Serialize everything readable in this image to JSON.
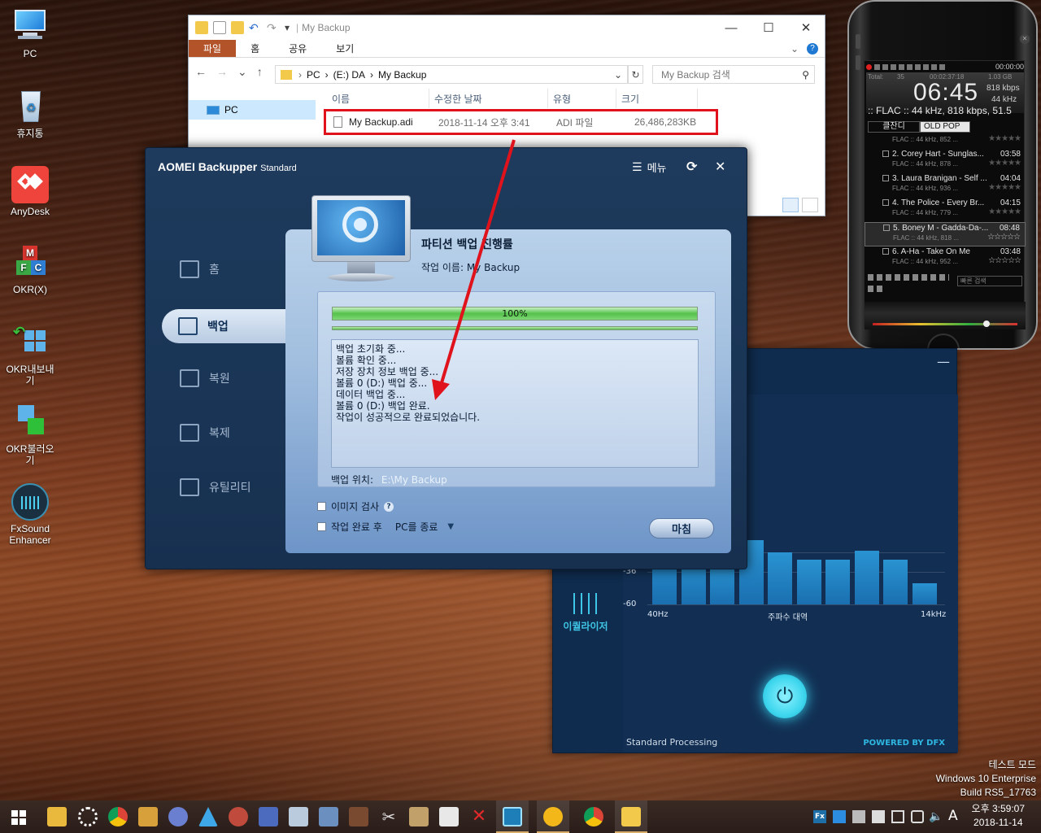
{
  "desktop": {
    "icons": [
      {
        "label": "PC",
        "name": "pc-icon"
      },
      {
        "label": "휴지통",
        "name": "recycle-bin-icon"
      },
      {
        "label": "AnyDesk",
        "name": "anydesk-icon"
      },
      {
        "label": "OKR(X)",
        "name": "okr-x-icon"
      },
      {
        "label": "OKR내보내기",
        "name": "okr-export-icon"
      },
      {
        "label": "OKR불러오기",
        "name": "okr-import-icon"
      },
      {
        "label": "FxSound\nEnhancer",
        "name": "fxsound-icon"
      }
    ]
  },
  "explorer": {
    "title": "My Backup",
    "ribbon_tabs": [
      "파일",
      "홈",
      "공유",
      "보기"
    ],
    "path": [
      "PC",
      "(E:) DA",
      "My Backup"
    ],
    "search_placeholder": "My Backup 검색",
    "sidebar_pc": "PC",
    "columns": [
      "이름",
      "수정한 날짜",
      "유형",
      "크기"
    ],
    "file": {
      "name": "My Backup.adi",
      "date": "2018-11-14 오후 3:41",
      "type": "ADI 파일",
      "size": "26,486,283KB"
    }
  },
  "aomei": {
    "title": "AOMEI Backupper",
    "edition": "Standard",
    "menu_label": "메뉴",
    "nav": [
      "홈",
      "백업",
      "복원",
      "복제",
      "유틸리티"
    ],
    "heading": "파티션 백업 진행률",
    "job_name": "작업 이름: My Backup",
    "progress": 1.0,
    "progress_label": "100%",
    "log": [
      "백업 초기화 중...",
      "볼륨 확인 중...",
      "저장 장치 정보 백업 중...",
      "볼륨 0 (D:) 백업 중...",
      "데이터 백업 중...",
      "볼륨 0 (D:) 백업 완료.",
      "작업이 성공적으로 완료되었습니다."
    ],
    "location_label": "백업 위치:",
    "location_path": "E:\\My Backup",
    "check_image": "이미지 검사",
    "check_after": "작업 완료 후",
    "after_action": "PC를 종료",
    "finish_label": "마침"
  },
  "fxsound": {
    "ticks": [
      "-36",
      "-60"
    ],
    "axis": [
      "40Hz",
      "주파수 대역",
      "14kHz"
    ],
    "eq_label": "이퀄라이저",
    "mode": "Standard Processing",
    "powered": "POWERED BY DFX",
    "bands": [
      0.55,
      0.44,
      0.36,
      0.61,
      0.49,
      0.42,
      0.42,
      0.51,
      0.42,
      0.2
    ]
  },
  "player": {
    "elapsed": "00:00:00",
    "total_label": "Total:",
    "total_count": "35",
    "total_time": "00:02:37:18",
    "total_size": "1.03 GB",
    "clock": "06:45",
    "bitrate": "818 kbps",
    "samplerate": "44 kHz",
    "now_format": ":: FLAC :: 44 kHz, 818 kbps, 51.5",
    "tabs": [
      "클잔디",
      "OLD POP ..."
    ],
    "tracks": [
      {
        "title": "",
        "dur": "",
        "info": "FLAC :: 44 kHz, 852 ..."
      },
      {
        "title": "2. Corey Hart - Sunglas...",
        "dur": "03:58",
        "info": "FLAC :: 44 kHz, 878 ..."
      },
      {
        "title": "3. Laura Branigan - Self ...",
        "dur": "04:04",
        "info": "FLAC :: 44 kHz, 936 ..."
      },
      {
        "title": "4. The Police - Every Br...",
        "dur": "04:15",
        "info": "FLAC :: 44 kHz, 779 ..."
      },
      {
        "title": "5. Boney M - Gadda-Da-...",
        "dur": "08:48",
        "info": "FLAC :: 44 kHz, 818 ..."
      },
      {
        "title": "6. A-Ha - Take On Me",
        "dur": "03:48",
        "info": "FLAC :: 44 kHz, 952 ..."
      }
    ],
    "search_placeholder": "빠른 검색"
  },
  "sysinfo": {
    "line1": "테스트 모드",
    "line2": "Windows 10 Enterprise",
    "line3": "Build  RS5_17763"
  },
  "taskbar": {
    "time": "오후 3:59:07",
    "date": "2018-11-14",
    "ime": "A"
  },
  "colors": {
    "aomei_bg": "#1e3a5c",
    "explorer_highlight": "#e0121b",
    "fx_accent": "#3fd7ee"
  }
}
